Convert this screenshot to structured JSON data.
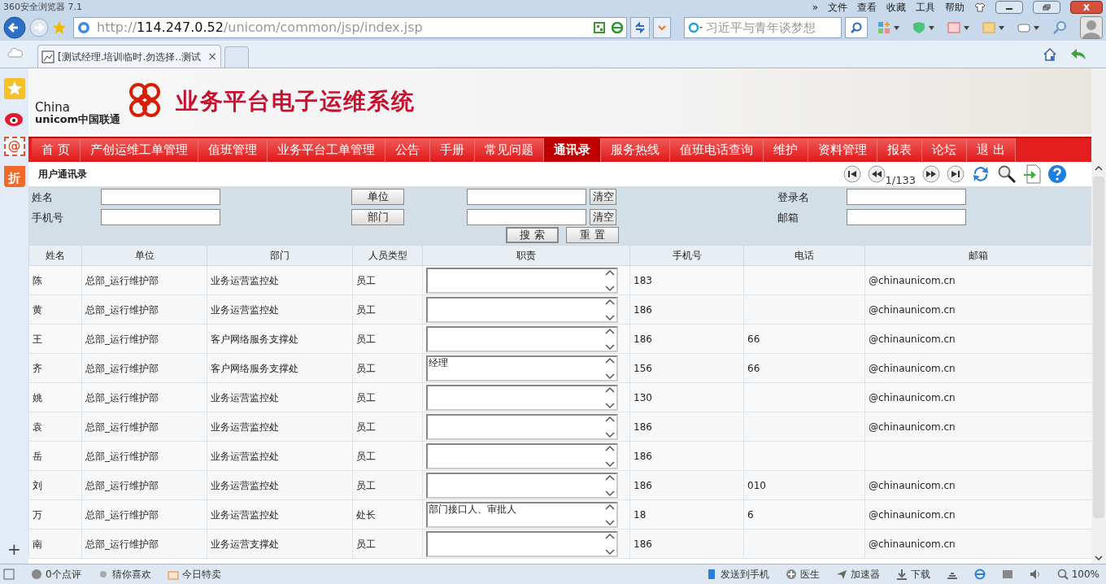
{
  "browser": {
    "title": "360安全浏览器 7.1",
    "menu": [
      "»",
      "文件",
      "查看",
      "收藏",
      "工具",
      "帮助"
    ],
    "address": {
      "host": "http://114.247.0.52",
      "path": "/unicom/common/jsp/index.jsp"
    },
    "search": {
      "placeholder": "习近平与青年谈梦想"
    },
    "tabs": [
      {
        "label": "[测试经理.培训临时.勿选择..测试",
        "selected": true,
        "close": "×"
      }
    ]
  },
  "sidebar": {
    "items": [
      {
        "kind": "star"
      },
      {
        "kind": "weibo"
      },
      {
        "kind": "mail",
        "label": "@"
      },
      {
        "kind": "sale",
        "label": "折"
      }
    ],
    "add": "+"
  },
  "header": {
    "logo_top": "China",
    "logo_bottom": "unicom中国联通",
    "title": "业务平台电子运维系统"
  },
  "nav": [
    {
      "label": "首 页",
      "selected": false
    },
    {
      "label": "产创运维工单管理",
      "selected": false
    },
    {
      "label": "值班管理",
      "selected": false
    },
    {
      "label": "业务平台工单管理",
      "selected": false
    },
    {
      "label": "公告",
      "selected": false
    },
    {
      "label": "手册",
      "selected": false
    },
    {
      "label": "常见问题",
      "selected": false
    },
    {
      "label": "通讯录",
      "selected": true
    },
    {
      "label": "服务热线",
      "selected": false
    },
    {
      "label": "值班电话查询",
      "selected": false
    },
    {
      "label": "维护",
      "selected": false
    },
    {
      "label": "资料管理",
      "selected": false
    },
    {
      "label": "报表",
      "selected": false
    },
    {
      "label": "论坛",
      "selected": false
    },
    {
      "label": "退 出",
      "selected": false
    }
  ],
  "section_title": "用户通讯录",
  "pager": "1/133",
  "filter": {
    "name_label": "姓名",
    "phone_label": "手机号",
    "unit_button": "单位",
    "dept_button": "部门",
    "clear_buttons": [
      "清空",
      "清空"
    ],
    "login_label": "登录名",
    "email_label": "邮箱",
    "search_button": "搜 索",
    "reset_button": "重 置"
  },
  "table": {
    "columns": [
      "姓名",
      "单位",
      "部门",
      "人员类型",
      "职责",
      "手机号",
      "电话",
      "邮箱"
    ],
    "rows": [
      [
        "陈",
        "总部_运行维护部",
        "业务运营监控处",
        "员工",
        "",
        "183",
        "",
        "@chinaunicom.cn"
      ],
      [
        "黄",
        "总部_运行维护部",
        "业务运营监控处",
        "员工",
        "",
        "186",
        "",
        "@chinaunicom.cn"
      ],
      [
        "王",
        "总部_运行维护部",
        "客户网络服务支撑处",
        "员工",
        "",
        "186",
        "66",
        "@chinaunicom.cn"
      ],
      [
        "齐",
        "总部_运行维护部",
        "客户网络服务支撑处",
        "员工",
        "经理",
        "156",
        "66",
        "@chinaunicom.cn"
      ],
      [
        "姚",
        "总部_运行维护部",
        "业务运营监控处",
        "员工",
        "",
        "130",
        "",
        "@chinaunicom.cn"
      ],
      [
        "袁",
        "总部_运行维护部",
        "业务运营监控处",
        "员工",
        "",
        "186",
        "",
        "@chinaunicom.cn"
      ],
      [
        "岳",
        "总部_运行维护部",
        "业务运营监控处",
        "员工",
        "",
        "186",
        "",
        ""
      ],
      [
        "刘",
        "总部_运行维护部",
        "业务运营监控处",
        "员工",
        "",
        "186",
        "010",
        "@chinaunicom.cn"
      ],
      [
        "万",
        "总部_运行维护部",
        "业务运营监控处",
        "处长",
        "部门接口人、审批人",
        "18",
        "6",
        "@chinaunicom.cn"
      ],
      [
        "南",
        "总部_运行维护部",
        "业务运营支撑处",
        "员工",
        "",
        "186",
        "",
        "@chinaunicom.cn"
      ]
    ]
  },
  "status_bar": {
    "left": [
      "0个点评",
      "猜你喜欢",
      "今日特卖"
    ],
    "right": [
      "发送到手机",
      "医生",
      "加速器",
      "下载"
    ],
    "zoom": "100%"
  }
}
